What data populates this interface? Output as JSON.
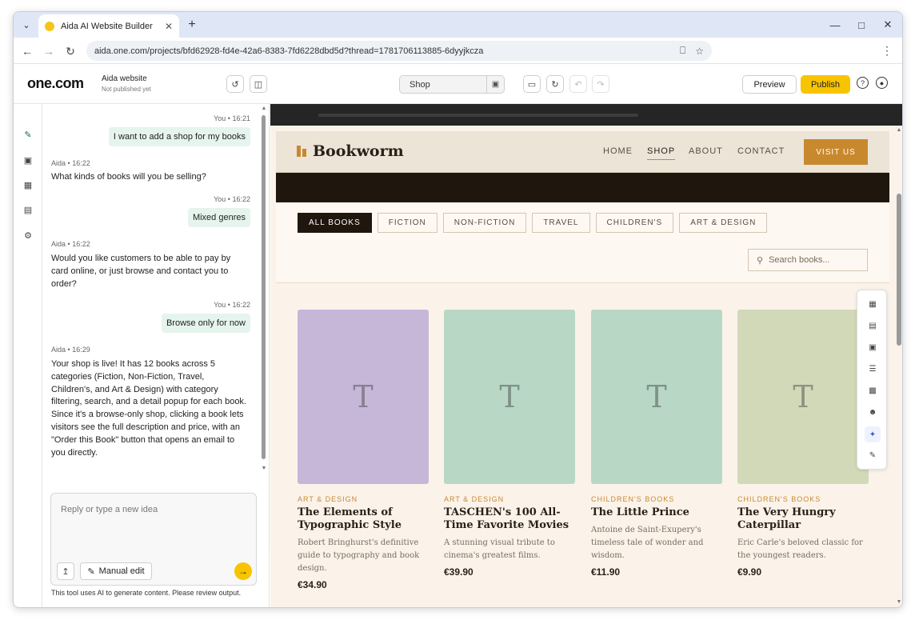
{
  "browser": {
    "tab_title": "Aida AI Website Builder",
    "url": "aida.one.com/projects/bfd62928-fd4e-42a6-8383-7fd6228dbd5d?thread=1781706113885-6dyyjkcza"
  },
  "header": {
    "logo": "one.com",
    "project_name": "Aida website",
    "project_status": "Not published yet",
    "page_selector": "Shop",
    "preview_label": "Preview",
    "publish_label": "Publish"
  },
  "chat": {
    "messages": [
      {
        "author": "You",
        "time": "16:21",
        "text": "I want to add a shop for my books"
      },
      {
        "author": "Aida",
        "time": "16:22",
        "text": "What kinds of books will you be selling?"
      },
      {
        "author": "You",
        "time": "16:22",
        "text": "Mixed genres"
      },
      {
        "author": "Aida",
        "time": "16:22",
        "text": "Would you like customers to be able to pay by card online, or just browse and contact you to order?"
      },
      {
        "author": "You",
        "time": "16:22",
        "text": "Browse only for now"
      },
      {
        "author": "Aida",
        "time": "16:29",
        "text": "Your shop is live! It has 12 books across 5 categories (Fiction, Non-Fiction, Travel, Children's, and Art & Design) with category filtering, search, and a detail popup for each book. Since it's a browse-only shop, clicking a book lets visitors see the full description and price, with an \"Order this Book\" button that opens an email to you directly."
      }
    ],
    "meta_separator": "•",
    "input_placeholder": "Reply or type a new idea",
    "manual_edit_label": "Manual edit",
    "disclaimer": "This tool uses AI to generate content. Please review output."
  },
  "site": {
    "brand": "Bookworm",
    "nav": [
      "HOME",
      "SHOP",
      "ABOUT",
      "CONTACT"
    ],
    "nav_active": "SHOP",
    "cta": "VISIT US",
    "filters": [
      "ALL BOOKS",
      "FICTION",
      "NON-FICTION",
      "TRAVEL",
      "CHILDREN'S",
      "ART & DESIGN"
    ],
    "filter_active": "ALL BOOKS",
    "search_placeholder": "Search books...",
    "books": [
      {
        "category": "ART & DESIGN",
        "title": "The Elements of Typographic Style",
        "description": "Robert Bringhurst's definitive guide to typography and book design.",
        "price": "€34.90",
        "cover_letter": "T",
        "cover_color": "#c6b7d9"
      },
      {
        "category": "ART & DESIGN",
        "title": "TASCHEN's 100 All-Time Favorite Movies",
        "description": "A stunning visual tribute to cinema's greatest films.",
        "price": "€39.90",
        "cover_letter": "T",
        "cover_color": "#b8d8c5"
      },
      {
        "category": "CHILDREN'S BOOKS",
        "title": "The Little Prince",
        "description": "Antoine de Saint-Exupery's timeless tale of wonder and wisdom.",
        "price": "€11.90",
        "cover_letter": "T",
        "cover_color": "#b8d8c5"
      },
      {
        "category": "CHILDREN'S BOOKS",
        "title": "The Very Hungry Caterpillar",
        "description": "Eric Carle's beloved classic for the youngest readers.",
        "price": "€9.90",
        "cover_letter": "T",
        "cover_color": "#d2d9b9"
      }
    ]
  },
  "colors": {
    "accent": "#f8c400",
    "site_accent": "#c8892e",
    "site_dark": "#1f160e"
  }
}
